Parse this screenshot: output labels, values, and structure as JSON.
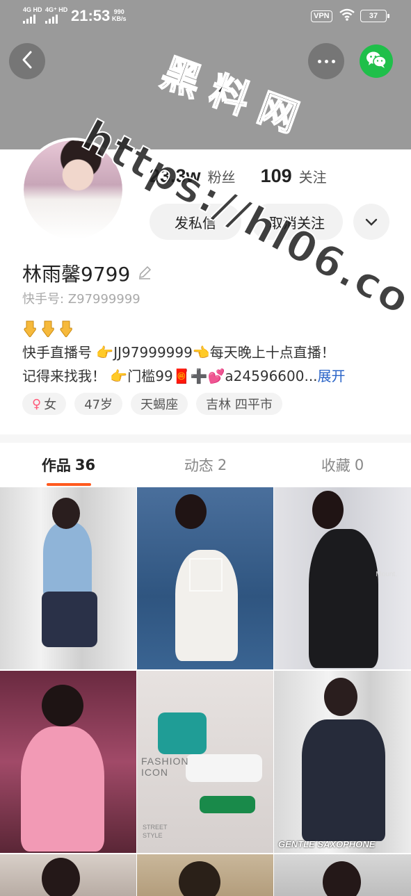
{
  "status_bar": {
    "net1": "4G HD",
    "net2": "4G⁺ HD",
    "time": "21:53",
    "speed_value": "990",
    "speed_unit": "KB/s",
    "vpn": "VPN",
    "battery": "37"
  },
  "header": {
    "back_icon": "chevron-left-icon",
    "more_icon": "more-horizontal-icon",
    "share_icon": "wechat-icon",
    "accent": "#1fbf4a"
  },
  "watermark": {
    "title": "黑料网",
    "url": "https://hl06.co"
  },
  "profile": {
    "followers_count": "23.3w",
    "followers_label": "粉丝",
    "following_count": "109",
    "following_label": "关注",
    "message_button": "发私信",
    "unfollow_button": "取消关注",
    "name": "林雨馨9799",
    "user_id": "快手号: Z97999999",
    "bio_line1": "快手直播号 👉JJ97999999👈每天晚上十点直播！",
    "bio_line2": "记得来找我！ 👉门槛99🧧➕💕a24596600...",
    "expand_label": "展开",
    "tags": {
      "gender": "女",
      "age": "47岁",
      "zodiac": "天蝎座",
      "location": "吉林 四平市"
    }
  },
  "tabs": [
    {
      "label": "作品",
      "count": "36"
    },
    {
      "label": "动态",
      "count": "2"
    },
    {
      "label": "收藏",
      "count": "0"
    }
  ],
  "grid": {
    "captions": {
      "c5a": "FASHION",
      "c5b": "ICON",
      "c5c": "STREET",
      "c5d": "STYLE",
      "c6": "GENTLE SAXOPHONE",
      "c3": "Mount."
    }
  }
}
